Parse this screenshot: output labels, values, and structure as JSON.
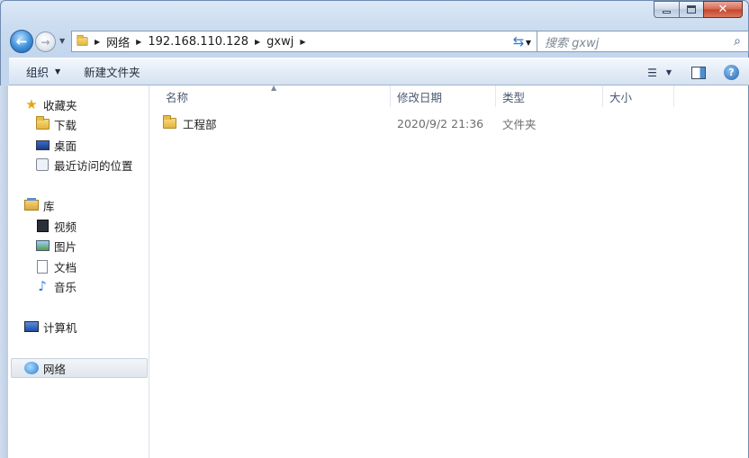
{
  "window": {
    "caption": {
      "minimize": "−",
      "maximize": "□",
      "close": "✕"
    }
  },
  "nav": {
    "back_icon": "back-arrow-icon",
    "forward_icon": "forward-arrow-icon",
    "address": {
      "crumbs": [
        "网络",
        "192.168.110.128",
        "gxwj"
      ]
    },
    "search": {
      "placeholder": "搜索 gxwj"
    }
  },
  "toolbar": {
    "organize": "组织",
    "new_folder": "新建文件夹"
  },
  "sidebar": {
    "favorites": {
      "label": "收藏夹",
      "items": [
        {
          "label": "下载"
        },
        {
          "label": "桌面"
        },
        {
          "label": "最近访问的位置"
        }
      ]
    },
    "libraries": {
      "label": "库",
      "items": [
        {
          "label": "视频"
        },
        {
          "label": "图片"
        },
        {
          "label": "文档"
        },
        {
          "label": "音乐"
        }
      ]
    },
    "computer": {
      "label": "计算机"
    },
    "network": {
      "label": "网络",
      "selected": true
    }
  },
  "file_list": {
    "columns": [
      "名称",
      "修改日期",
      "类型",
      "大小"
    ],
    "rows": [
      {
        "name": "工程部",
        "modified": "2020/9/2 21:36",
        "type": "文件夹",
        "size": ""
      }
    ]
  }
}
